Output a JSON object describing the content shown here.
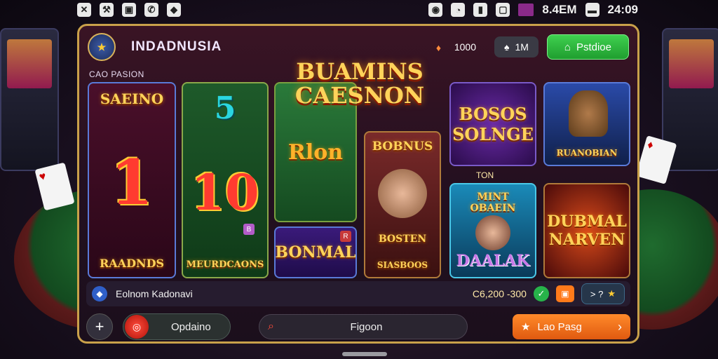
{
  "status_bar": {
    "left_icons": [
      "x-icon",
      "tools-icon",
      "camera-icon",
      "phone-off-icon",
      "shield-icon"
    ],
    "left_icon_glyphs": [
      "✕",
      "⚒",
      "▣",
      "✆",
      "◆"
    ],
    "right_text_1": "8.4EM",
    "time": "24:09"
  },
  "header": {
    "title": "INDADNUSIA",
    "logo_glyph": "★",
    "balance": "1000",
    "pill_label": "1M",
    "pill_glyph": "♠",
    "button_label": "Pstdioe",
    "button_glyph": "⌂"
  },
  "section_label": "CAO PASION",
  "headline": "BUAMINS CAESNON",
  "tiles": {
    "t1": {
      "top": "SAEINO",
      "big": "1",
      "bottom": "RAADNDS"
    },
    "t2": {
      "top": "5",
      "big": "10",
      "bottom": "MEURDCAONS",
      "badge": "B"
    },
    "t3": {
      "big": "Rlon"
    },
    "t3b": {
      "label": "BONMAL",
      "badge": "R"
    },
    "t4": {
      "top": "BOBNUS",
      "mid": "BOSTEN",
      "bottom": "SIASBOOS"
    },
    "t5": {
      "line1": "BOSOS",
      "line2": "SOLNGE"
    },
    "t6": {
      "label": "RUANOBIAN"
    },
    "t7": {
      "line1": "MINT OBAEIN",
      "line2": "DAALAK"
    },
    "t8": {
      "line1": "DUBMAL",
      "line2": "NARVEN"
    }
  },
  "tori_label": "TON",
  "info_bar": {
    "text": "Eolnom Kadonavi",
    "jackpot": "C6,200 -300",
    "share_label": "> ?"
  },
  "bottom_bar": {
    "option_label": "Opdaino",
    "search_value": "Figoon",
    "cta_label": "Lao Pasg"
  },
  "colors": {
    "frame": "#c9a14a",
    "accent_green": "#2fb53f",
    "accent_orange": "#ff7a1a",
    "gold": "#ffd35a"
  }
}
